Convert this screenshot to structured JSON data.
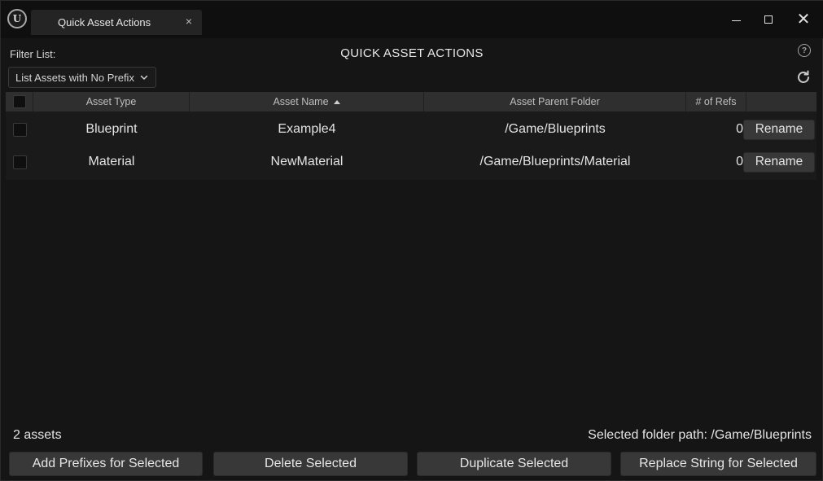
{
  "window": {
    "tab_title": "Quick Asset Actions",
    "tab_close_glyph": "×",
    "close_glyph": "✕",
    "logo_text": "U"
  },
  "toolbar": {
    "filter_label": "Filter List:",
    "filter_selected": "List Assets with No Prefix",
    "panel_title": "QUICK ASSET ACTIONS",
    "help_glyph": "?"
  },
  "table": {
    "headers": {
      "type": "Asset Type",
      "name": "Asset Name",
      "folder": "Asset Parent Folder",
      "refs": "# of Refs"
    },
    "rows": [
      {
        "type": "Blueprint",
        "name": "Example4",
        "folder": "/Game/Blueprints",
        "refs": "0",
        "action": "Rename"
      },
      {
        "type": "Material",
        "name": "NewMaterial",
        "folder": "/Game/Blueprints/Material",
        "refs": "0",
        "action": "Rename"
      }
    ]
  },
  "footer": {
    "asset_count": "2 assets",
    "folder_path": "Selected folder path: /Game/Blueprints",
    "buttons": [
      "Add Prefixes for Selected",
      "Delete Selected",
      "Duplicate Selected",
      "Replace String for Selected"
    ]
  },
  "icons": {
    "logo": "unreal-logo-icon",
    "help": "help-icon",
    "refresh": "refresh-icon",
    "chevron": "chevron-down-icon",
    "sort": "sort-ascending-icon"
  },
  "colors": {
    "background": "#151515",
    "titlebar": "#0f0f0f",
    "header_row": "#2f2f2f",
    "button": "#383838",
    "text": "#e4e4e4"
  }
}
